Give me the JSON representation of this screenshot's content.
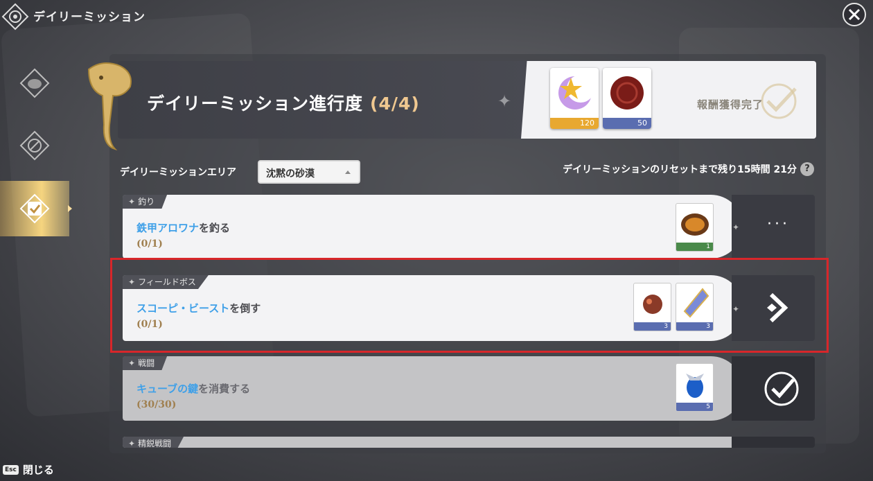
{
  "header": {
    "title": "デイリーミッション",
    "close_label": "閉じる",
    "esc_key": "Esc"
  },
  "sidebar": {
    "items": [
      {
        "name": "sidebar-item-emblem",
        "icon": "compass-animal-icon",
        "active": false
      },
      {
        "name": "sidebar-item-compass",
        "icon": "compass-icon",
        "active": false
      },
      {
        "name": "sidebar-item-daily",
        "icon": "clipboard-check-icon",
        "active": true
      }
    ]
  },
  "banner": {
    "title": "デイリーミッション進行度",
    "progress": "(4/4)",
    "rewards": [
      {
        "icon": "moon-star-icon",
        "qty": "120",
        "rarity_color": "#e8a830"
      },
      {
        "icon": "wax-seal-icon",
        "qty": "50",
        "rarity_color": "#5a6db0"
      }
    ],
    "claimed_label": "報酬獲得完了"
  },
  "area": {
    "label": "デイリーミッションエリア",
    "selected": "沈黙の砂漠"
  },
  "reset": {
    "text": "デイリーミッションのリセットまで残り15時間 21分",
    "help": "?"
  },
  "missions": [
    {
      "category": "釣り",
      "target": "鉄甲アロワナ",
      "suffix": "を釣る",
      "progress": "(0/1)",
      "items": [
        {
          "icon": "grilled-fish-icon",
          "qty": "1",
          "rarity_color": "#4a8a4a"
        }
      ],
      "status": "in-progress"
    },
    {
      "category": "フィールドボス",
      "target": "スコーピ・ビースト",
      "suffix": "を倒す",
      "progress": "(0/1)",
      "items": [
        {
          "icon": "gem-cluster-icon",
          "qty": "3",
          "rarity_color": "#5a6db0"
        },
        {
          "icon": "crystal-icon",
          "qty": "3",
          "rarity_color": "#5a6db0"
        }
      ],
      "status": "go"
    },
    {
      "category": "戦闘",
      "target": "キューブの鍵",
      "suffix": "を消費する",
      "progress": "(30/30)",
      "items": [
        {
          "icon": "blue-gem-icon",
          "qty": "5",
          "rarity_color": "#5a6db0"
        }
      ],
      "status": "done"
    },
    {
      "category": "精鋭戦闘"
    }
  ]
}
